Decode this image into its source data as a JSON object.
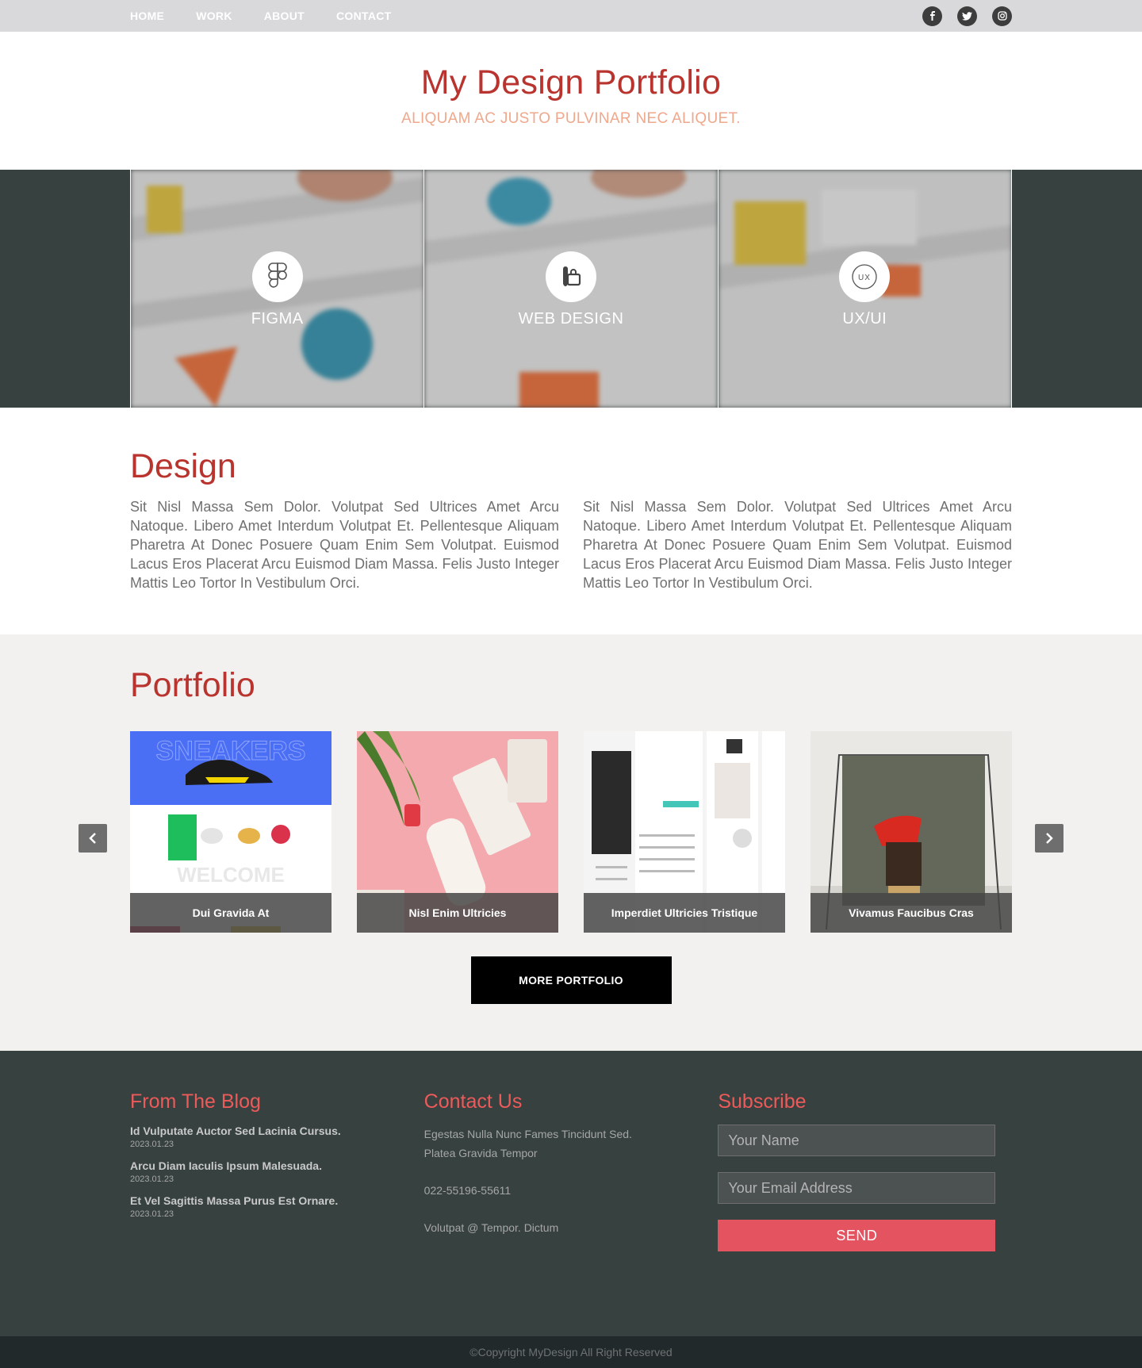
{
  "nav": {
    "links": [
      "HOME",
      "WORK",
      "ABOUT",
      "CONTACT"
    ],
    "social": [
      "facebook-icon",
      "twitter-icon",
      "instagram-icon"
    ]
  },
  "header": {
    "title": "My Design Portfolio",
    "subtitle": "ALIQUAM AC JUSTO PULVINAR NEC ALIQUET."
  },
  "hero": {
    "panels": [
      {
        "label": "FIGMA",
        "icon": "figma-icon"
      },
      {
        "label": "WEB DESIGN",
        "icon": "web-design-icon"
      },
      {
        "label": "UX/UI",
        "icon": "ux-icon",
        "icon_text": "UX"
      }
    ]
  },
  "design": {
    "title": "Design",
    "paragraphs": [
      "Sit Nisl Massa Sem Dolor. Volutpat Sed Ultrices Amet Arcu Natoque. Libero Amet Interdum Volutpat Et. Pellentesque Aliquam Pharetra At Donec Posuere Quam Enim Sem Volutpat. Euismod Lacus Eros Placerat Arcu Euismod Diam Massa. Felis Justo Integer Mattis Leo Tortor In Vestibulum Orci.",
      "Sit Nisl Massa Sem Dolor. Volutpat Sed Ultrices Amet Arcu Natoque. Libero Amet Interdum Volutpat Et. Pellentesque Aliquam Pharetra At Donec Posuere Quam Enim Sem Volutpat. Euismod Lacus Eros Placerat Arcu Euismod Diam Massa. Felis Justo Integer Mattis Leo Tortor In Vestibulum Orci."
    ]
  },
  "portfolio": {
    "title": "Portfolio",
    "items": [
      "Dui Gravida At",
      "Nisl Enim Ultricies",
      "Imperdiet Ultricies Tristique",
      "Vivamus Faucibus Cras"
    ],
    "more_label": "MORE PORTFOLIO"
  },
  "footer": {
    "blog": {
      "title": "From The Blog",
      "posts": [
        {
          "title": "Id Vulputate Auctor Sed Lacinia Cursus.",
          "date": "2023.01.23"
        },
        {
          "title": "Arcu Diam Iaculis Ipsum Malesuada.",
          "date": "2023.01.23"
        },
        {
          "title": "Et Vel Sagittis Massa Purus Est Ornare.",
          "date": "2023.01.23"
        }
      ]
    },
    "contact": {
      "title": "Contact Us",
      "address_line1": "Egestas Nulla Nunc Fames Tincidunt Sed.",
      "address_line2": "Platea Gravida Tempor",
      "phone": "022-55196-55611",
      "email": "Volutpat @ Tempor. Dictum"
    },
    "subscribe": {
      "title": "Subscribe",
      "name_placeholder": "Your Name",
      "email_placeholder": "Your Email Address",
      "send_label": "SEND"
    }
  },
  "copyright": "©Copyright MyDesign All Right Reserved",
  "colors": {
    "accent": "#b9342e",
    "footer_accent": "#ec5a5a",
    "send_button": "#e35360",
    "dark_bg": "#374140"
  }
}
